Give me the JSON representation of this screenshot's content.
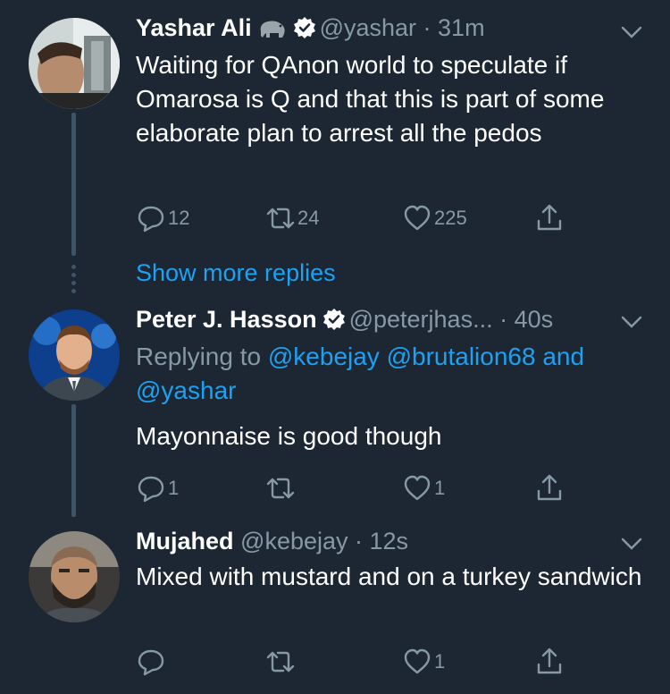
{
  "tweets": [
    {
      "name": "Yashar Ali",
      "handle": "@yashar",
      "time": "31m",
      "text": "Waiting for QAnon world to speculate if Omarosa is Q and that this is part of some elaborate plan to arrest all the pedos",
      "reply_count": "12",
      "retweet_count": "24",
      "like_count": "225"
    },
    {
      "name": "Peter J. Hasson",
      "handle": "@peterjhas...",
      "time": "40s",
      "replying_prefix": "Replying to",
      "replying_1": "@kebejay",
      "replying_2": "@brutalion68",
      "replying_and": "and",
      "replying_3": "@yashar",
      "text": "Mayonnaise is good though",
      "reply_count": "1",
      "retweet_count": "",
      "like_count": "1"
    },
    {
      "name": "Mujahed",
      "handle": "@kebejay",
      "time": "12s",
      "text": "Mixed with mustard and on a turkey sandwich",
      "reply_count": "",
      "retweet_count": "",
      "like_count": "1"
    }
  ],
  "show_more_label": "Show more replies",
  "icons": {
    "reply": "reply-icon",
    "retweet": "retweet-icon",
    "like": "heart-icon",
    "share": "share-icon",
    "more": "chevron-down-icon",
    "verified": "verified-badge-icon",
    "emoji": "elephant-emoji-icon"
  },
  "colors": {
    "background": "#1c2733",
    "text": "#ffffff",
    "muted": "#8899a6",
    "link": "#1da1f2",
    "thread": "#3d5466"
  }
}
